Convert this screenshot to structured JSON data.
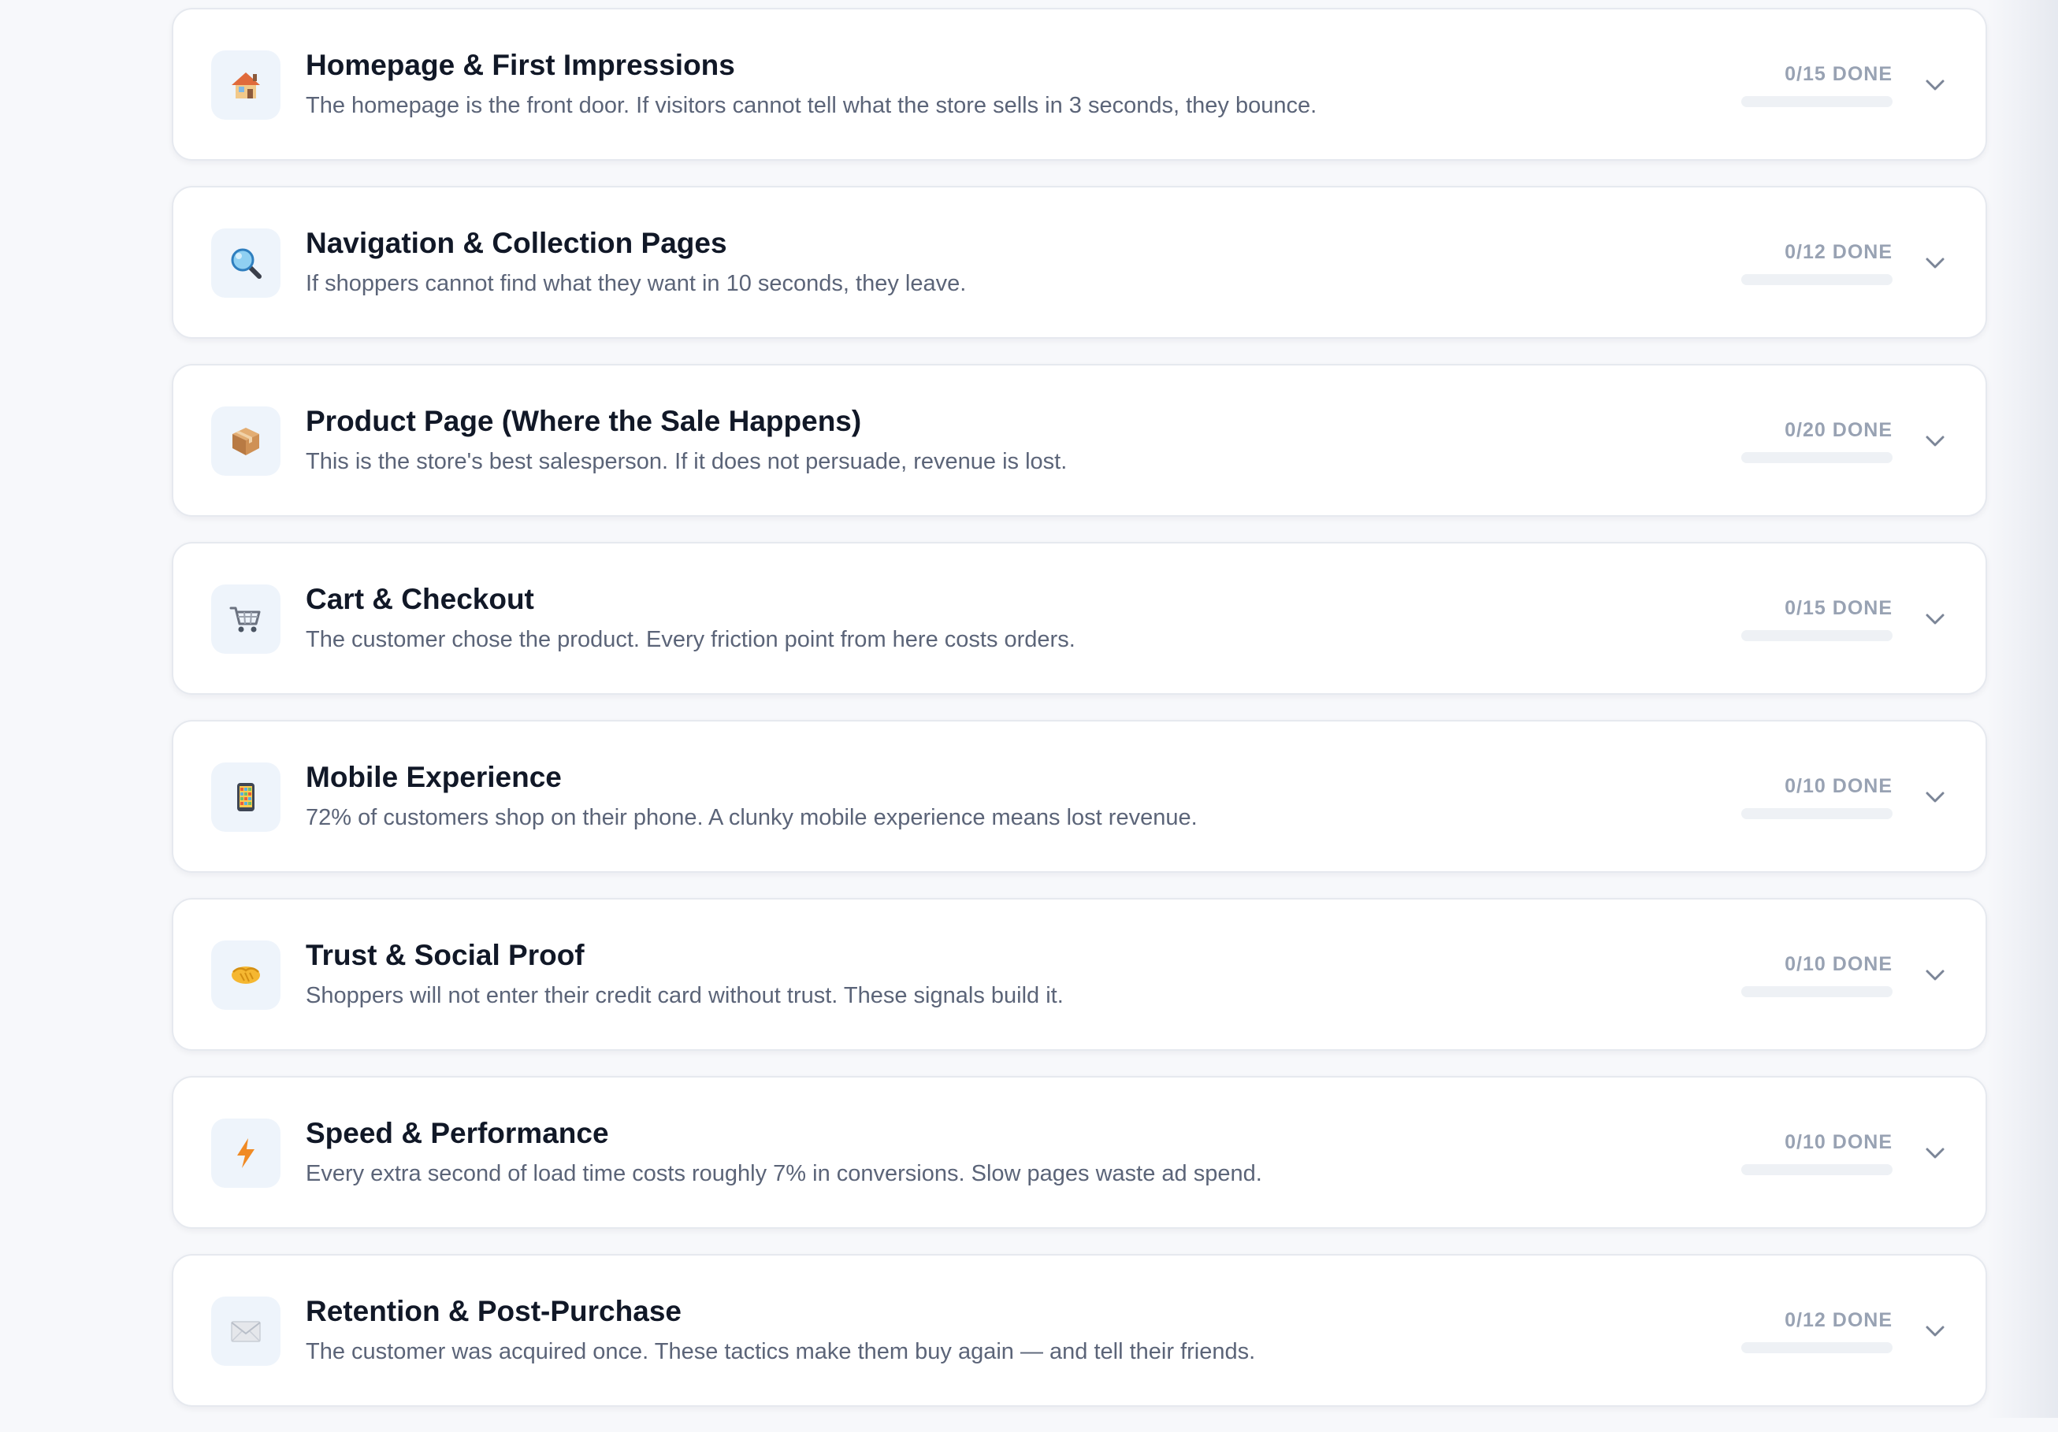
{
  "checklist": {
    "sections": [
      {
        "icon": "house-icon",
        "title": "Homepage & First Impressions",
        "description": "The homepage is the front door. If visitors cannot tell what the store sells in 3 seconds, they bounce.",
        "status": "0/15 DONE",
        "progress": 0
      },
      {
        "icon": "magnifier-icon",
        "title": "Navigation & Collection Pages",
        "description": "If shoppers cannot find what they want in 10 seconds, they leave.",
        "status": "0/12 DONE",
        "progress": 0
      },
      {
        "icon": "package-icon",
        "title": "Product Page (Where the Sale Happens)",
        "description": "This is the store's best salesperson. If it does not persuade, revenue is lost.",
        "status": "0/20 DONE",
        "progress": 0
      },
      {
        "icon": "cart-icon",
        "title": "Cart & Checkout",
        "description": "The customer chose the product. Every friction point from here costs orders.",
        "status": "0/15 DONE",
        "progress": 0
      },
      {
        "icon": "mobile-icon",
        "title": "Mobile Experience",
        "description": "72% of customers shop on their phone. A clunky mobile experience means lost revenue.",
        "status": "0/10 DONE",
        "progress": 0
      },
      {
        "icon": "handshake-icon",
        "title": "Trust & Social Proof",
        "description": "Shoppers will not enter their credit card without trust. These signals build it.",
        "status": "0/10 DONE",
        "progress": 0
      },
      {
        "icon": "lightning-icon",
        "title": "Speed & Performance",
        "description": "Every extra second of load time costs roughly 7% in conversions. Slow pages waste ad spend.",
        "status": "0/10 DONE",
        "progress": 0
      },
      {
        "icon": "envelope-icon",
        "title": "Retention & Post-Purchase",
        "description": "The customer was acquired once. These tactics make them buy again — and tell their friends.",
        "status": "0/12 DONE",
        "progress": 0
      }
    ]
  },
  "colors": {
    "title": "#111827",
    "description": "#5b6478",
    "status": "#98a2b3",
    "icon_bg": "#eef4fb",
    "card_border": "#e6e9ef",
    "progress_track": "#eef1f5"
  }
}
